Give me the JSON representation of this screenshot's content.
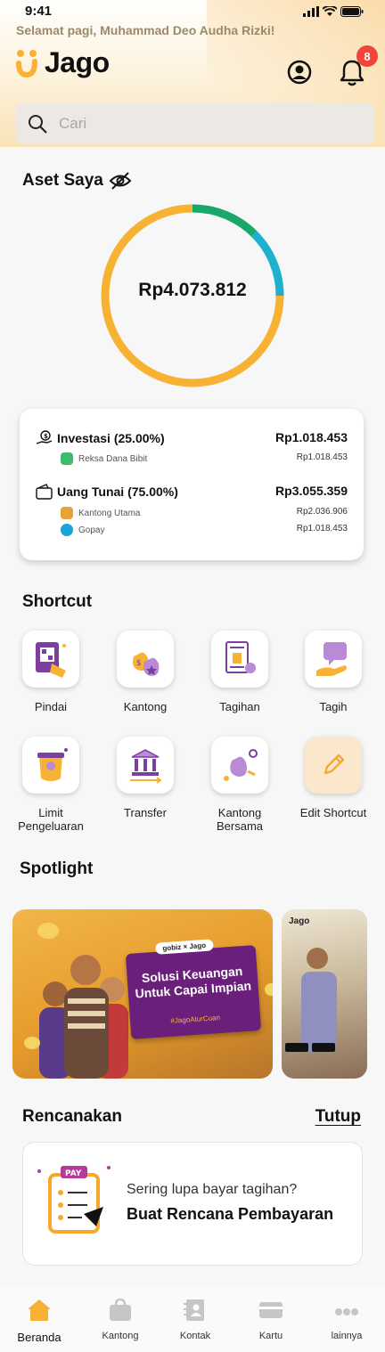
{
  "status_bar": {
    "time": "9:41"
  },
  "header": {
    "greeting": "Selamat pagi, Muhammad Deo Audha Rizki!",
    "brand": "Jago",
    "notification_count": "8"
  },
  "search": {
    "placeholder": "Cari"
  },
  "assets": {
    "title": "Aset Saya",
    "total": "Rp4.073.812",
    "chart_data": {
      "type": "pie",
      "categories": [
        "Uang Tunai",
        "Investasi (Reksa Dana Bibit)",
        "Investasi (Gopay)"
      ],
      "values": [
        75,
        12.5,
        12.5
      ],
      "colors": [
        "#f7b233",
        "#1aa76a",
        "#1fb0d0"
      ]
    },
    "groups": [
      {
        "label": "Investasi (25.00%)",
        "amount": "Rp1.018.453",
        "items": [
          {
            "label": "Reksa Dana Bibit",
            "amount": "Rp1.018.453",
            "icon": "bibit-icon",
            "color": "#3cbc6e"
          }
        ]
      },
      {
        "label": "Uang Tunai (75.00%)",
        "amount": "Rp3.055.359",
        "items": [
          {
            "label": "Kantong Utama",
            "amount": "Rp2.036.906",
            "icon": "kantong-utama-icon",
            "color": "#e8a23a"
          },
          {
            "label": "Gopay",
            "amount": "Rp1.018.453",
            "icon": "gopay-icon",
            "color": "#1aa3d9"
          }
        ]
      }
    ]
  },
  "shortcut": {
    "title": "Shortcut",
    "items": [
      {
        "label": "Pindai",
        "icon": "scan-qr-icon"
      },
      {
        "label": "Kantong",
        "icon": "money-bags-icon"
      },
      {
        "label": "Tagihan",
        "icon": "bill-icon"
      },
      {
        "label": "Tagih",
        "icon": "request-money-icon"
      },
      {
        "label": "Limit Pengeluaran",
        "icon": "spending-limit-icon"
      },
      {
        "label": "Transfer",
        "icon": "bank-transfer-icon"
      },
      {
        "label": "Kantong Bersama",
        "icon": "shared-pocket-icon"
      },
      {
        "label": "Edit Shortcut",
        "icon": "pencil-icon"
      }
    ]
  },
  "spotlight": {
    "title": "Spotlight",
    "banner1": {
      "brand": "gobiz × Jago",
      "headline": "Solusi Keuangan Untuk Capai Impian",
      "hashtag": "#JagoAturCuan"
    },
    "banner2": {
      "brand": "Jago"
    }
  },
  "plan": {
    "title": "Rencanakan",
    "close_label": "Tutup",
    "icon_text": "PAY",
    "question": "Sering lupa bayar tagihan?",
    "cta": "Buat Rencana Pembayaran"
  },
  "bottom_nav": [
    {
      "label": "Beranda",
      "icon": "home-icon",
      "active": true
    },
    {
      "label": "Kantong",
      "icon": "bag-icon"
    },
    {
      "label": "Kontak",
      "icon": "contacts-icon"
    },
    {
      "label": "Kartu",
      "icon": "card-icon"
    },
    {
      "label": "lainnya",
      "icon": "more-icon"
    }
  ]
}
